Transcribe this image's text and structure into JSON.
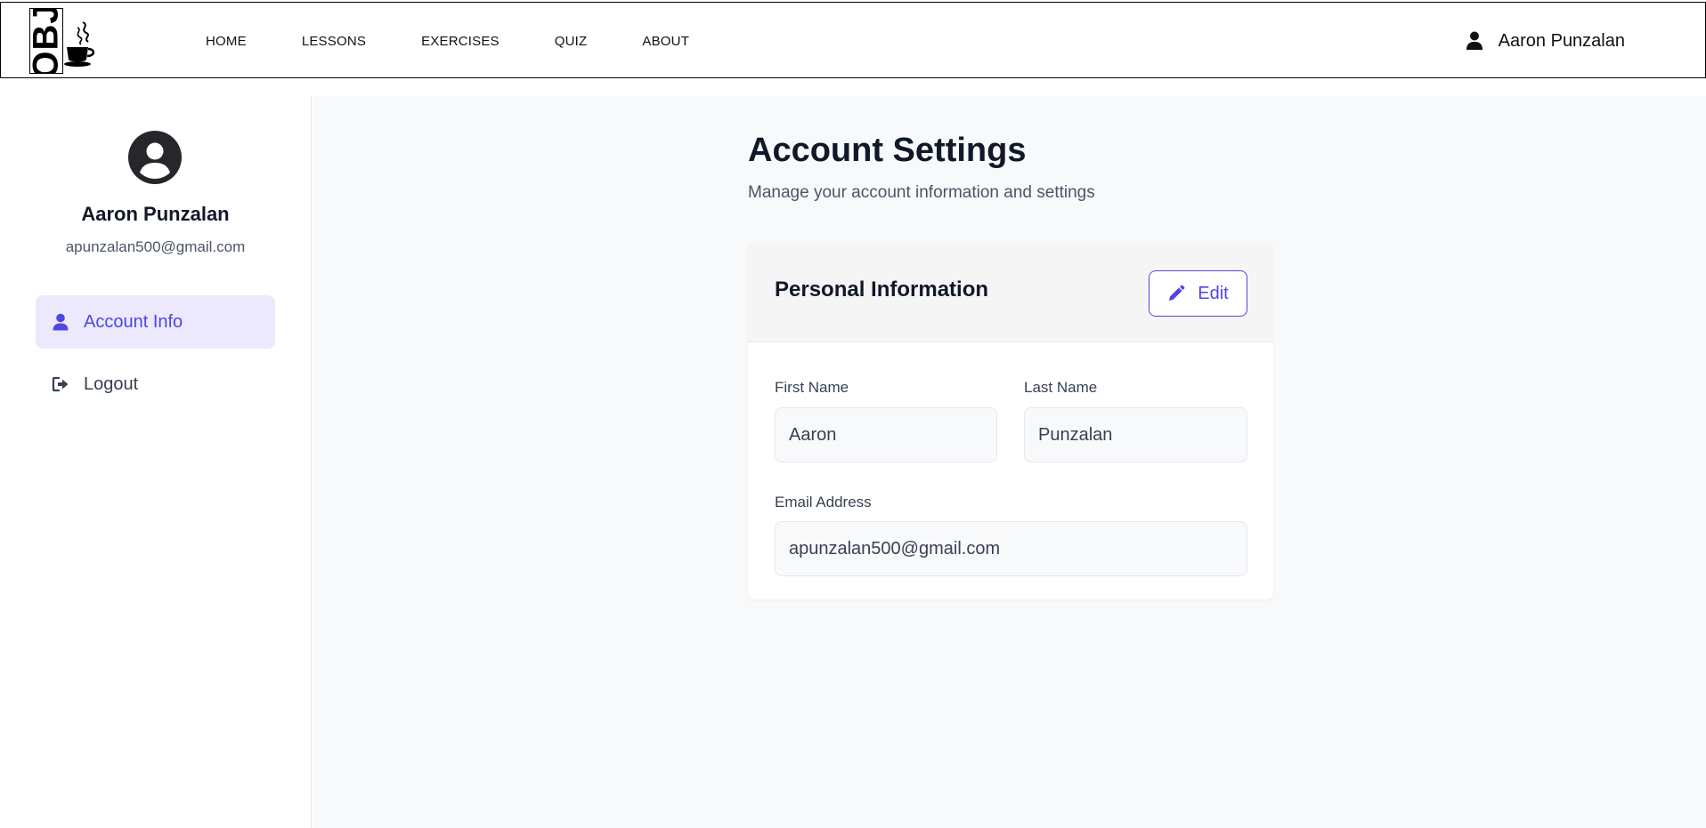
{
  "navbar": {
    "logo_text": "OBJ",
    "links": [
      "HOME",
      "LESSONS",
      "EXERCISES",
      "QUIZ",
      "ABOUT"
    ],
    "user_name": "Aaron Punzalan"
  },
  "sidebar": {
    "profile_name": "Aaron Punzalan",
    "profile_email": "apunzalan500@gmail.com",
    "items": [
      {
        "label": "Account Info",
        "icon": "user-icon"
      },
      {
        "label": "Logout",
        "icon": "logout-icon"
      }
    ]
  },
  "main": {
    "title": "Account Settings",
    "subtitle": "Manage your account information and settings",
    "card": {
      "title": "Personal Information",
      "edit_label": "Edit",
      "fields": {
        "first_name": {
          "label": "First Name",
          "value": "Aaron"
        },
        "last_name": {
          "label": "Last Name",
          "value": "Punzalan"
        },
        "email": {
          "label": "Email Address",
          "value": "apunzalan500@gmail.com"
        }
      }
    }
  },
  "colors": {
    "accent": "#4f46e5",
    "accent_bg": "#ebe9fb",
    "text_dark": "#111827",
    "text_muted": "#4b5563"
  }
}
